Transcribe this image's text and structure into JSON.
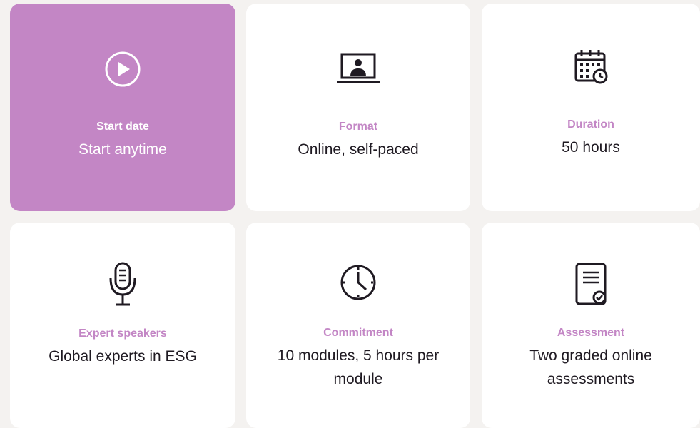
{
  "cards": [
    {
      "label": "Start date",
      "value": "Start anytime",
      "icon": "play-circle-icon",
      "active": true
    },
    {
      "label": "Format",
      "value": "Online, self-paced",
      "icon": "laptop-person-icon"
    },
    {
      "label": "Duration",
      "value": "50 hours",
      "icon": "calendar-clock-icon"
    },
    {
      "label": "Expert speakers",
      "value": "Global experts in ESG",
      "icon": "microphone-icon"
    },
    {
      "label": "Commitment",
      "value": "10 modules, 5 hours per module",
      "icon": "clock-icon"
    },
    {
      "label": "Assessment",
      "value": "Two graded online assessments",
      "icon": "document-check-icon"
    }
  ],
  "colors": {
    "accent": "#c386c5",
    "text": "#1f1a22",
    "background": "#f4f2f0"
  }
}
